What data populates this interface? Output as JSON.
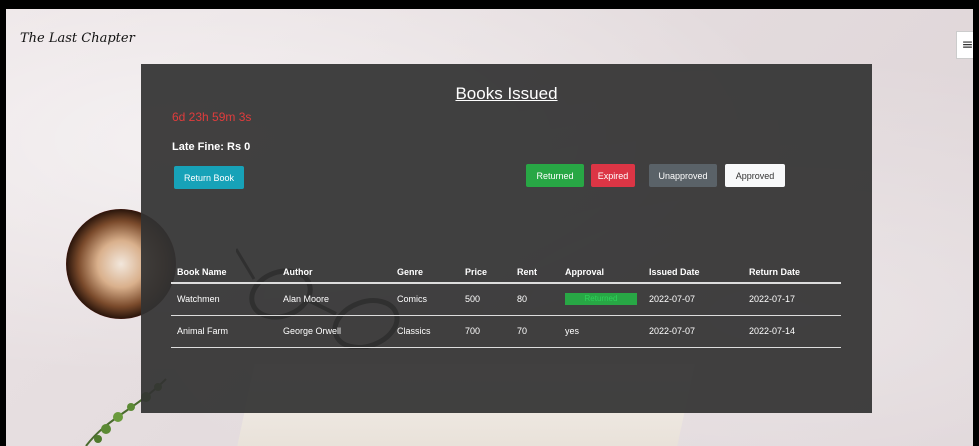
{
  "brand": {
    "name": "The Last Chapter"
  },
  "menu": {
    "icon": "hamburger-icon",
    "glyph": "≡"
  },
  "panel": {
    "title": "Books Issued",
    "timer": "6d 23h 59m 3s",
    "late_fine": "Late Fine: Rs 0",
    "return_button": "Return Book",
    "legend": {
      "returned": "Returned",
      "expired": "Expired",
      "unapproved": "Unapproved",
      "approved": "Approved"
    }
  },
  "table": {
    "headers": [
      "Book Name",
      "Author",
      "Genre",
      "Price",
      "Rent",
      "Approval",
      "Issued Date",
      "Return Date"
    ],
    "rows": [
      {
        "book": "Watchmen",
        "author": "Alan Moore",
        "genre": "Comics",
        "price": "500",
        "rent": "80",
        "approval": "Returned",
        "issued": "2022-07-07",
        "return": "2022-07-17"
      },
      {
        "book": "Animal Farm",
        "author": "George Orwell",
        "genre": "Classics",
        "price": "700",
        "rent": "70",
        "approval": "yes",
        "issued": "2022-07-07",
        "return": "2022-07-14"
      }
    ]
  },
  "colors": {
    "panel_bg": "#333333",
    "timer": "#e03c3c",
    "info": "#17a2b8",
    "success": "#28a745",
    "danger": "#dc3545",
    "secondary": "#5a6268",
    "light": "#f8f9fa"
  }
}
